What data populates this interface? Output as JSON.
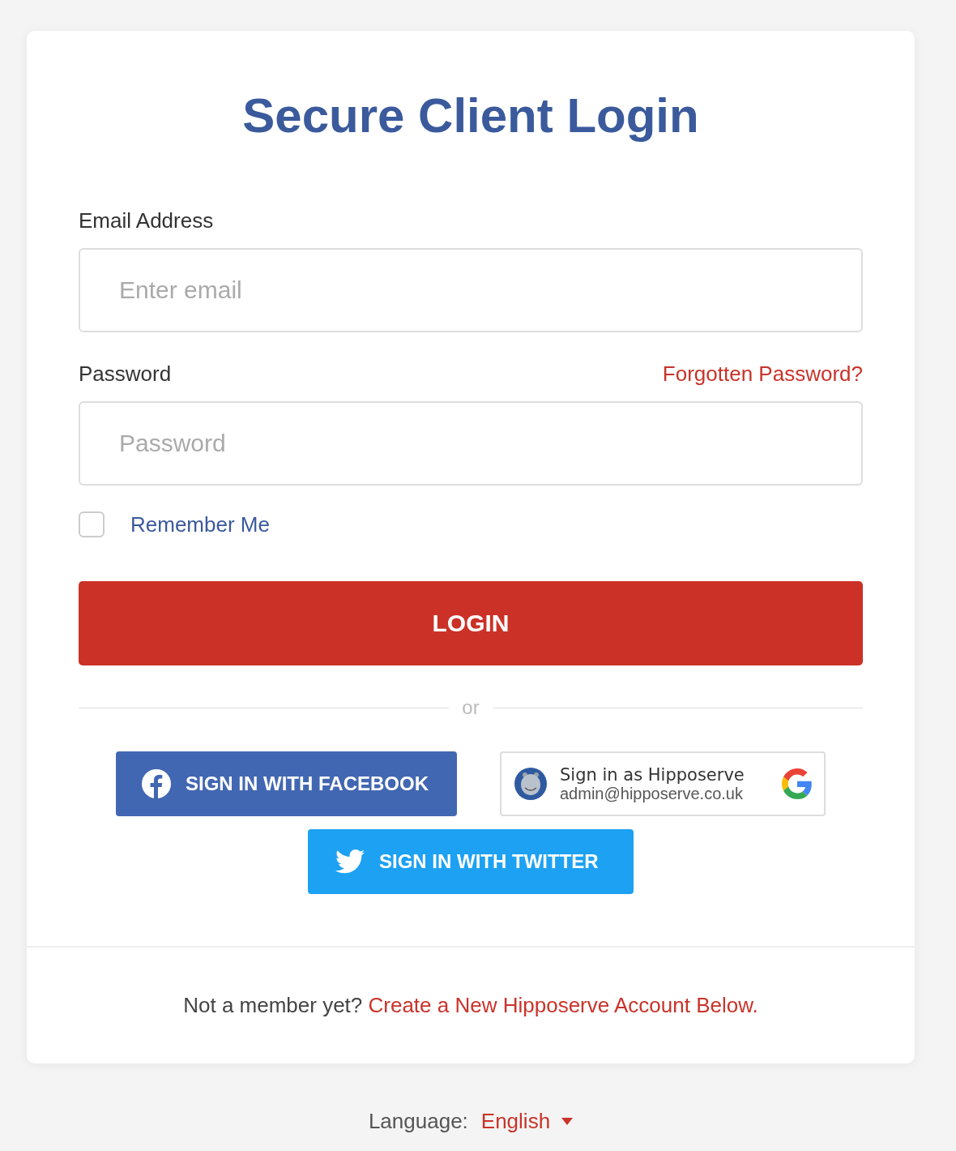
{
  "title": "Secure Client Login",
  "fields": [
    {
      "label": "Email Address",
      "placeholder": "Enter email"
    },
    {
      "label": "Password",
      "placeholder": "Password",
      "link": "Forgotten Password?"
    }
  ],
  "remember": {
    "label": "Remember Me",
    "checked": false
  },
  "login_button": "LOGIN",
  "divider": "or",
  "social": [
    {
      "kind": "facebook",
      "label": "SIGN IN WITH FACEBOOK"
    },
    {
      "kind": "google",
      "title": "Sign in as Hipposerve",
      "email": "admin@hipposerve.co.uk"
    },
    {
      "kind": "twitter",
      "label": "SIGN IN WITH TWITTER"
    }
  ],
  "footer": {
    "text": "Not a member yet?",
    "link": "Create a New Hipposerve Account Below."
  },
  "language": {
    "label": "Language:",
    "value": "English"
  }
}
